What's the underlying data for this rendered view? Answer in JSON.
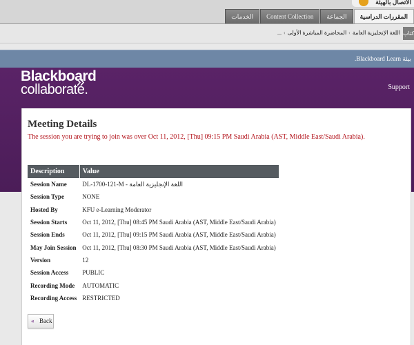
{
  "header": {
    "logo_text": "الاتصال بالهيئة",
    "tabs": [
      {
        "label": "المقررات الدراسية",
        "active": true
      },
      {
        "label": "الجماعة",
        "active": false
      },
      {
        "label": "Content Collection",
        "active": false
      },
      {
        "label": "الخدمات",
        "active": false
      }
    ]
  },
  "breadcrumb": {
    "handle_label": "كتاب",
    "items": [
      "اللغة الإنجليزية العامة",
      "المحاضرة المباشرة الأولى",
      "..."
    ]
  },
  "notice_bar": {
    "text": "بيئة Blackboard Learn."
  },
  "collaborate": {
    "logo_line1": "Blackboard",
    "logo_line2": "collaborate.",
    "support_label": "Support"
  },
  "meeting": {
    "title": "Meeting Details",
    "error_message": "The session you are trying to join was over Oct 11, 2012, [Thu] 09:15 PM Saudi Arabia (AST, Middle East/Saudi Arabia).",
    "table_headers": {
      "description": "Description",
      "value": "Value"
    },
    "rows": [
      {
        "key": "Session Name",
        "value": "DL-1700-121-M - اللغة الإنجليزية العامة"
      },
      {
        "key": "Session Type",
        "value": "NONE"
      },
      {
        "key": "Hosted By",
        "value": "KFU e-Learning Moderator"
      },
      {
        "key": "Session Starts",
        "value": "Oct 11, 2012, [Thu] 08:45 PM Saudi Arabia (AST, Middle East/Saudi Arabia)"
      },
      {
        "key": "Session Ends",
        "value": "Oct 11, 2012, [Thu] 09:15 PM Saudi Arabia (AST, Middle East/Saudi Arabia)"
      },
      {
        "key": "May Join Session",
        "value": "Oct 11, 2012, [Thu] 08:30 PM Saudi Arabia (AST, Middle East/Saudi Arabia)"
      },
      {
        "key": "Version",
        "value": "12"
      },
      {
        "key": "Session Access",
        "value": "PUBLIC"
      },
      {
        "key": "Recording Mode",
        "value": "AUTOMATIC"
      },
      {
        "key": "Recording Access",
        "value": "RESTRICTED"
      }
    ],
    "back_label": "Back",
    "back_icon": "double-chevron-left-icon"
  },
  "colors": {
    "purple_header": "#4b1d58",
    "error_red": "#b3131b",
    "table_header": "#555b60",
    "notice_blue": "#6e87a6"
  }
}
